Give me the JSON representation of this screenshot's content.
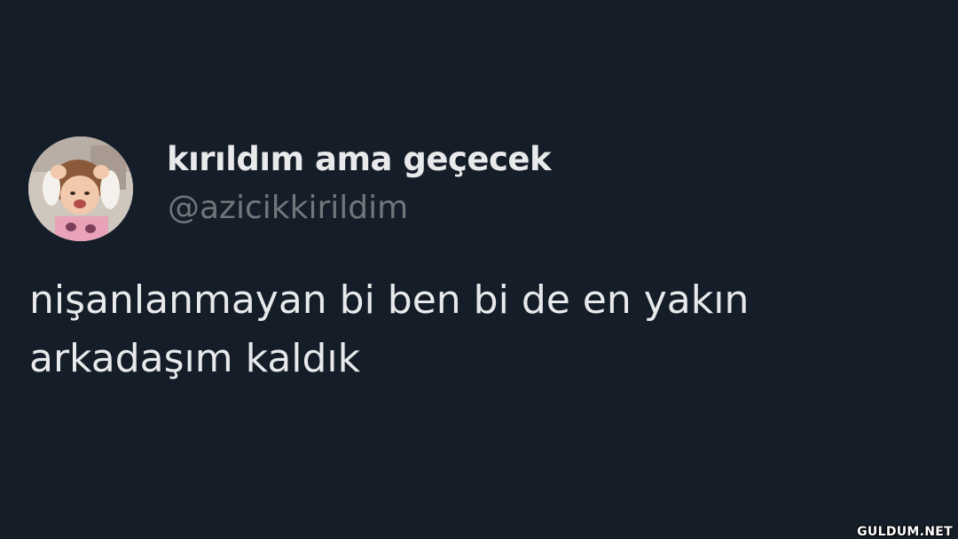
{
  "tweet": {
    "display_name": "kırıldım ama geçecek",
    "handle": "@azicikkirildim",
    "text_lines": [
      "nişanlanmayan bi ben bi de en yakın",
      "arkadaşım kaldık"
    ]
  },
  "watermark": "GULDUM.NET",
  "colors": {
    "background": "#151d28",
    "primary_text": "#e7e9ea",
    "secondary_text": "#71767b"
  }
}
